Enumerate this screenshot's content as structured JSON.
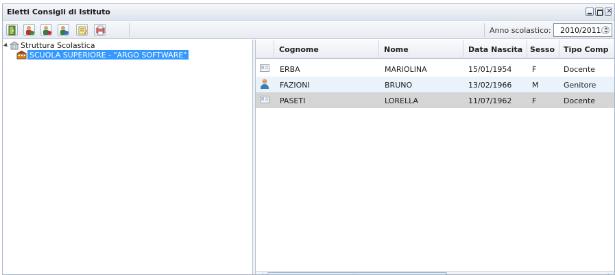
{
  "window": {
    "title": "Eletti Consigli di Istituto"
  },
  "toolbar": {
    "buttons": [
      {
        "icon": "exit-icon"
      },
      {
        "icon": "person-add-icon"
      },
      {
        "icon": "person-remove-icon"
      },
      {
        "icon": "person-edit-icon"
      },
      {
        "icon": "notes-icon"
      },
      {
        "icon": "print-icon"
      }
    ],
    "anno_label": "Anno scolastico:",
    "anno_value": "2010/2011"
  },
  "tree": {
    "root_label": "Struttura Scolastica",
    "child_label": "SCUOLA SUPERIORE - \"ARGO SOFTWARE\""
  },
  "grid": {
    "columns": [
      "Cognome",
      "Nome",
      "Data Nascita",
      "Sesso",
      "Tipo Comp"
    ],
    "rows": [
      {
        "icon": "id-card-icon",
        "cognome": "ERBA",
        "nome": "MARIOLINA",
        "data": "15/01/1954",
        "sesso": "F",
        "tipo": "Docente"
      },
      {
        "icon": "person-icon",
        "cognome": "FAZIONI",
        "nome": "BRUNO",
        "data": "13/02/1966",
        "sesso": "M",
        "tipo": "Genitore"
      },
      {
        "icon": "id-card-icon",
        "cognome": "PASETI",
        "nome": "LORELLA",
        "data": "11/07/1962",
        "sesso": "F",
        "tipo": "Docente"
      }
    ]
  },
  "colors": {
    "selection": "#3399ff",
    "alt_row": "#eaf3fb",
    "selected_row": "#d5d5d5"
  }
}
